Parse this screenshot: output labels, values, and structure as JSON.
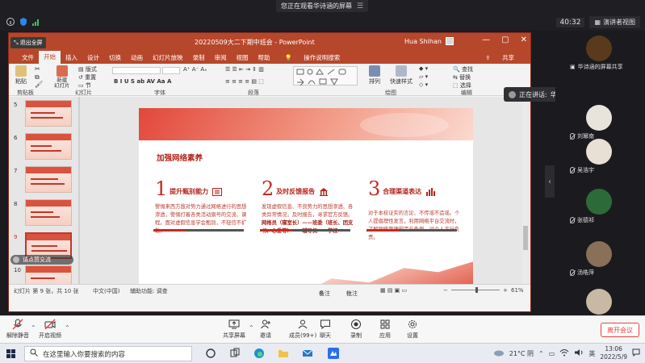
{
  "meeting": {
    "share_banner": "您正在观看华诗涵的屏幕",
    "timer": "40:32",
    "view_button": "演讲者视图",
    "speaking_prefix": "正在讲话:",
    "speaking_name": "华诗涵",
    "side_toggle": "‹",
    "participants": [
      {
        "name": "华诗涵的屏幕共享",
        "color": "#5a3a1c"
      },
      {
        "name": "",
        "color": "#e8e4dc"
      },
      {
        "name": "刘幂南",
        "color": "#3c3c3c"
      },
      {
        "name": "吴浩宇",
        "color": "#e8e0d4"
      },
      {
        "name": "张德祁",
        "color": "#2d6a3a"
      },
      {
        "name": "汤皓萍",
        "color": "#8a7058"
      },
      {
        "name": "",
        "color": "#c7b9a3"
      }
    ],
    "toolbar": {
      "mute": "解除静音",
      "video": "开启视频",
      "share": "共享屏幕",
      "invite": "邀请",
      "members": "成员(99+)",
      "chat": "聊天",
      "record": "录制",
      "apps": "应用",
      "settings": "设置",
      "leave": "离开会议"
    }
  },
  "ppt": {
    "exit_fullscreen": "退出全屏",
    "doc_title": "20220509大二下期中班会  -  PowerPoint",
    "user": "Hua Shihan",
    "window_controls": [
      "—",
      "▢",
      "✕"
    ],
    "tabs": [
      "文件",
      "开始",
      "插入",
      "设计",
      "切换",
      "动画",
      "幻灯片放映",
      "录制",
      "审阅",
      "视图",
      "帮助",
      "操作说明搜索"
    ],
    "active_tab": "开始",
    "share_label": "共享",
    "ribbon": {
      "paste": "粘贴",
      "new_slide": "新建\n幻灯片",
      "layout": "版式",
      "reset": "重置",
      "section": "节",
      "arrange": "排列",
      "quick_styles": "快速样式",
      "find": "查找",
      "replace": "替换",
      "select": "选择",
      "groups": [
        "剪贴板",
        "幻灯片",
        "字体",
        "段落",
        "绘图",
        "编辑"
      ]
    },
    "thumbnails": [
      "5",
      "6",
      "7",
      "8",
      "9",
      "10"
    ],
    "selected_thumb": "9",
    "ask": "请点赞交流",
    "status": {
      "slide_info": "幻灯片 第 9 张，共 10 张",
      "language": "中文(中国)",
      "accessibility": "辅助功能: 调查",
      "notes": "备注",
      "comments": "批注",
      "zoom": "61%"
    }
  },
  "slide": {
    "heading": "加强网络素养",
    "columns": [
      {
        "num": "1",
        "title": "提升甄别能力",
        "text": "警惕来西方敌对势力通过网络进行的思想渗透，警惕打着各类活动旗号的交流、课程。面对虚假信息学会甄别，不轻信不扩散。"
      },
      {
        "num": "2",
        "title": "及时反馈报告",
        "text": "发现虚假信息、不良势力的思想渗透、各类异常情况，及时报告，寻求官方反馈。",
        "bold": "网格员（寝室长）——班委（班长、团支书、心委等）——辅导员——学校"
      },
      {
        "num": "3",
        "title": "合理渠道表达",
        "text": "对于本校证实的言论、不传谣不造谣。个人提倡理性发言，利用网络平台交流时，了解网络管理规定与条例，对个人言行负责。"
      }
    ]
  },
  "taskbar": {
    "search_placeholder": "在这里输入你要搜索的内容",
    "weather": "21°C 阴",
    "ime": "英",
    "time": "13:06",
    "date": "2022/5/9"
  }
}
